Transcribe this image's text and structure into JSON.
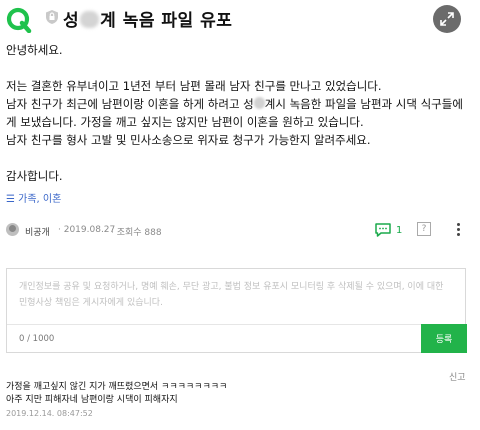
{
  "header": {
    "title_start": "성",
    "title_end": "계 녹음 파일 유포"
  },
  "post": {
    "greeting": "안녕하세요.",
    "line1": "저는 결혼한 유부녀이고 1년전 부터 남편 몰래  남자 친구를 만나고 있었습니다.",
    "line2_start": "남자 친구가 최근에 남편이랑 이혼을 하게 하려고 성",
    "line2_end": "계시 녹음한 파일을 남편과 시댁 식구들에",
    "line3": "게 보냈습니다. 가정을 깨고 싶지는 않지만 남편이 이혼을 원하고 있습니다.",
    "line4": "남자 친구를 형사 고발 및 민사소송으로 위자료 청구가 가능한지 알려주세요.",
    "closing": "감사합니다."
  },
  "tags": "☰ 가족, 이혼",
  "meta": {
    "author": "비공개",
    "date": "· 2019.08.27",
    "views": "· 조회수 888",
    "comment_count": "1",
    "help_label": "?"
  },
  "comment_form": {
    "placeholder": "개인정보를 공유 및 요청하거나, 명예 훼손, 무단 광고, 불법 정보 유포시 모니터링 후 삭제될 수 있으며, 이에 대한 민형사상 책임은 게시자에게 있습니다.",
    "char_count": "0 / 1000",
    "submit_label": "등록"
  },
  "reply": {
    "report_label": "신고",
    "line1": "가정을 깨고싶지 않긴 지가 깨뜨렸으면서 ㅋㅋㅋㅋㅋㅋㅋㅋ",
    "line2": "아주 지만 피해자네 남편이랑 시댁이 피해자지",
    "date": "2019.12.14. 08:47:52"
  },
  "colors": {
    "accent_green": "#22b34a",
    "tag_blue": "#3b67c9"
  },
  "icons": {
    "logo": "naver-q-logo-icon",
    "lock": "lock-icon",
    "expand": "expand-icon",
    "comment": "comment-bubble-icon",
    "more": "more-vertical-icon"
  }
}
